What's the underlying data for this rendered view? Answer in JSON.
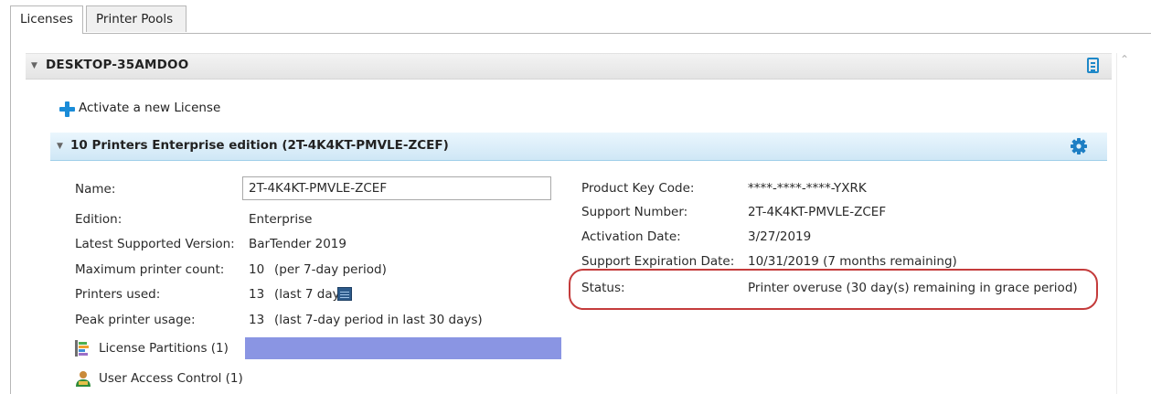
{
  "tabs": [
    {
      "label": "Licenses",
      "active": true
    },
    {
      "label": "Printer Pools",
      "active": false
    }
  ],
  "machine": {
    "name": "DESKTOP-35AMDOO"
  },
  "activate_label": "Activate a new License",
  "license": {
    "title": "10 Printers Enterprise edition (2T-4K4KT-PMVLE-ZCEF)",
    "left_fields": {
      "name_label": "Name:",
      "name_value": "2T-4K4KT-PMVLE-ZCEF",
      "edition_label": "Edition:",
      "edition_value": "Enterprise",
      "latest_label": "Latest Supported Version:",
      "latest_value": "BarTender 2019",
      "max_label": "Maximum printer count:",
      "max_value": "10",
      "max_note": "(per 7-day period)",
      "used_label": "Printers used:",
      "used_value": "13",
      "used_note": "(last 7 days)",
      "peak_label": "Peak printer usage:",
      "peak_value": "13",
      "peak_note": "(last 7-day period in last 30 days)"
    },
    "right_fields": {
      "pkc_label": "Product Key Code:",
      "pkc_value": "****-****-****-YXRK",
      "support_label": "Support Number:",
      "support_value": "2T-4K4KT-PMVLE-ZCEF",
      "activation_label": "Activation Date:",
      "activation_value": "3/27/2019",
      "expiration_label": "Support Expiration Date:",
      "expiration_value": "10/31/2019 (7 months remaining)",
      "status_label": "Status:",
      "status_value": "Printer overuse (30 day(s) remaining in grace period)"
    },
    "partitions_label": "License Partitions (1)",
    "uac_label": "User Access Control (1)"
  },
  "colors": {
    "accent": "#1a8cd8",
    "status_ring": "#c43b3b",
    "partition_bar": "#8a95e3"
  },
  "icons": [
    "chevron-down-icon",
    "menu-icon",
    "plus-icon",
    "gear-icon",
    "calendar-icon",
    "partition-icon",
    "user-icon",
    "scroll-up-icon"
  ]
}
